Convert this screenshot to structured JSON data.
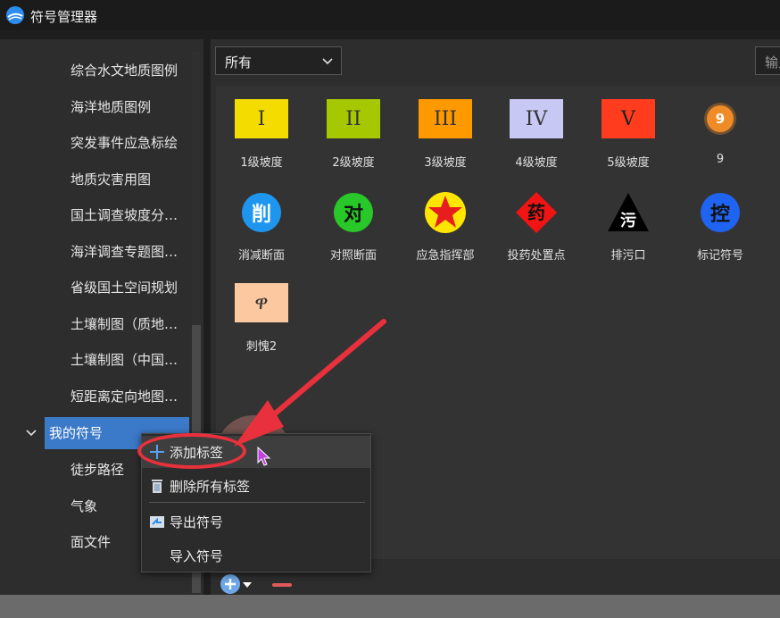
{
  "window": {
    "title": "符号管理器"
  },
  "tree": {
    "items": [
      "综合水文地质图例",
      "海洋地质图例",
      "突发事件应急标绘",
      "地质灾害用图",
      "国土调查坡度分…",
      "海洋调查专题图…",
      "省级国土空间规划",
      "土壤制图（质地…",
      "土壤制图（中国…",
      "短距离定向地图…"
    ],
    "selected": "我的符号",
    "children": [
      "徒步路径",
      "气象",
      "面文件"
    ]
  },
  "toolbar": {
    "category": "所有",
    "search_placeholder": "输入"
  },
  "symbols": [
    {
      "label": "1级坡度",
      "glyph": "I",
      "shape": "rect",
      "bg": "#f5dc00",
      "fg": "#333333"
    },
    {
      "label": "2级坡度",
      "glyph": "II",
      "shape": "rect",
      "bg": "#a6c800",
      "fg": "#333333"
    },
    {
      "label": "3级坡度",
      "glyph": "III",
      "shape": "rect",
      "bg": "#ff9900",
      "fg": "#333333"
    },
    {
      "label": "4级坡度",
      "glyph": "IV",
      "shape": "rect",
      "bg": "#c8c8f5",
      "fg": "#333333"
    },
    {
      "label": "5级坡度",
      "glyph": "V",
      "shape": "rect",
      "bg": "#ff3c1e",
      "fg": "#222222"
    },
    {
      "label": "9",
      "glyph": "9",
      "shape": "circle-small",
      "bg": "#f08c28",
      "fg": "#ffffff"
    },
    {
      "label": "消减断面",
      "glyph": "削",
      "shape": "circle",
      "bg": "#1e96f0",
      "fg": "#ffffff"
    },
    {
      "label": "对照断面",
      "glyph": "对",
      "shape": "circle",
      "bg": "#28c828",
      "fg": "#111111"
    },
    {
      "label": "应急指挥部",
      "glyph": "★",
      "shape": "star",
      "bg": "#ffe600",
      "fg": "#e61e1e"
    },
    {
      "label": "投药处置点",
      "glyph": "药",
      "shape": "diamond",
      "bg": "#f01414",
      "fg": "#111111"
    },
    {
      "label": "排污口",
      "glyph": "污",
      "shape": "triangle",
      "bg": "#000000",
      "fg": "#ffffff"
    },
    {
      "label": "标记符号",
      "glyph": "控",
      "shape": "circle",
      "bg": "#1e64f0",
      "fg": "#111111"
    },
    {
      "label": "刺愧2",
      "glyph": "ዋ",
      "shape": "rect",
      "bg": "#fcc8a0",
      "fg": "#333333"
    }
  ],
  "context_menu": {
    "items": [
      "添加标签",
      "删除所有标签",
      "导出符号",
      "导入符号"
    ]
  },
  "colors": {
    "accent": "#3b79c9",
    "annotation": "#e8313c"
  }
}
